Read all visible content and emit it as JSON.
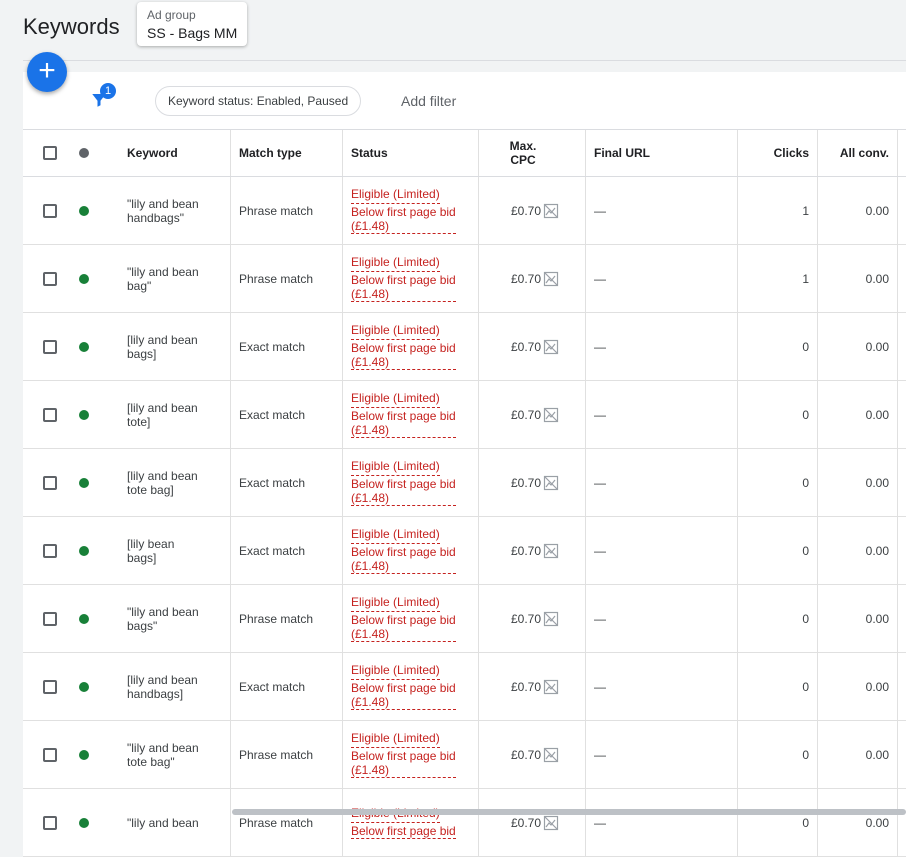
{
  "header": {
    "title": "Keywords",
    "adgroup_caption": "Ad group",
    "adgroup_value": "SS - Bags MM"
  },
  "toolbar": {
    "add_icon": "plus-icon",
    "filter_icon": "filter-icon",
    "filter_count": "1",
    "status_chip": "Keyword status: Enabled, Paused",
    "add_filter": "Add filter"
  },
  "columns": {
    "keyword": "Keyword",
    "match_type": "Match type",
    "status": "Status",
    "max_cpc": "Max.\nCPC",
    "final_url": "Final URL",
    "clicks": "Clicks",
    "all_conv": "All conv."
  },
  "colors": {
    "accent": "#1a73e8",
    "enabled_dot": "#188038",
    "limited_status": "#c5221f"
  },
  "rows": [
    {
      "keyword": "\"lily and bean\nhandbags\"",
      "match_type": "Phrase match",
      "status": "Eligible (Limited)",
      "status_detail": "Below first page bid (£1.48)",
      "max_cpc": "£0.70",
      "final_url": "—",
      "clicks": "1",
      "all_conv": "0.00"
    },
    {
      "keyword": "\"lily and bean\nbag\"",
      "match_type": "Phrase match",
      "status": "Eligible (Limited)",
      "status_detail": "Below first page bid (£1.48)",
      "max_cpc": "£0.70",
      "final_url": "—",
      "clicks": "1",
      "all_conv": "0.00"
    },
    {
      "keyword": "[lily and bean\nbags]",
      "match_type": "Exact match",
      "status": "Eligible (Limited)",
      "status_detail": "Below first page bid (£1.48)",
      "max_cpc": "£0.70",
      "final_url": "—",
      "clicks": "0",
      "all_conv": "0.00"
    },
    {
      "keyword": "[lily and bean\ntote]",
      "match_type": "Exact match",
      "status": "Eligible (Limited)",
      "status_detail": "Below first page bid (£1.48)",
      "max_cpc": "£0.70",
      "final_url": "—",
      "clicks": "0",
      "all_conv": "0.00"
    },
    {
      "keyword": "[lily and bean\ntote bag]",
      "match_type": "Exact match",
      "status": "Eligible (Limited)",
      "status_detail": "Below first page bid (£1.48)",
      "max_cpc": "£0.70",
      "final_url": "—",
      "clicks": "0",
      "all_conv": "0.00"
    },
    {
      "keyword": "[lily bean\nbags]",
      "match_type": "Exact match",
      "status": "Eligible (Limited)",
      "status_detail": "Below first page bid (£1.48)",
      "max_cpc": "£0.70",
      "final_url": "—",
      "clicks": "0",
      "all_conv": "0.00"
    },
    {
      "keyword": "\"lily and bean\nbags\"",
      "match_type": "Phrase match",
      "status": "Eligible (Limited)",
      "status_detail": "Below first page bid (£1.48)",
      "max_cpc": "£0.70",
      "final_url": "—",
      "clicks": "0",
      "all_conv": "0.00"
    },
    {
      "keyword": "[lily and bean\nhandbags]",
      "match_type": "Exact match",
      "status": "Eligible (Limited)",
      "status_detail": "Below first page bid (£1.48)",
      "max_cpc": "£0.70",
      "final_url": "—",
      "clicks": "0",
      "all_conv": "0.00"
    },
    {
      "keyword": "\"lily and bean\ntote bag\"",
      "match_type": "Phrase match",
      "status": "Eligible (Limited)",
      "status_detail": "Below first page bid (£1.48)",
      "max_cpc": "£0.70",
      "final_url": "—",
      "clicks": "0",
      "all_conv": "0.00"
    },
    {
      "keyword": "\"lily and bean",
      "match_type": "Phrase match",
      "status": "Eligible (Limited)",
      "status_detail": "Below first page bid",
      "max_cpc": "£0.70",
      "final_url": "—",
      "clicks": "0",
      "all_conv": "0.00"
    }
  ]
}
